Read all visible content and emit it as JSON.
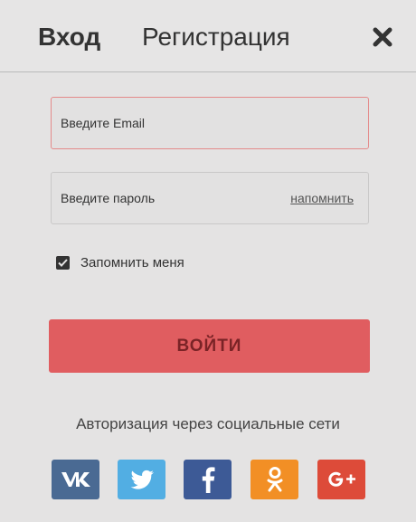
{
  "tabs": {
    "login": "Вход",
    "register": "Регистрация"
  },
  "form": {
    "email_placeholder": "Введите Email",
    "password_placeholder": "Введите пароль",
    "remind_label": "напомнить",
    "remember_label": "Запомнить меня",
    "remember_checked": true,
    "submit_label": "ВОЙТИ"
  },
  "social": {
    "title": "Авторизация через социальные сети",
    "buttons": [
      {
        "icon": "vk-icon",
        "color": "#4a6a93"
      },
      {
        "icon": "twitter-icon",
        "color": "#52aee3"
      },
      {
        "icon": "facebook-icon",
        "color": "#3d5a96"
      },
      {
        "icon": "odnoklassniki-icon",
        "color": "#f28f25"
      },
      {
        "icon": "google-plus-icon",
        "color": "#dd4b39"
      }
    ]
  },
  "colors": {
    "accent": "#e05d60",
    "email_border": "#e48b8b",
    "background": "#e4e3e3"
  }
}
